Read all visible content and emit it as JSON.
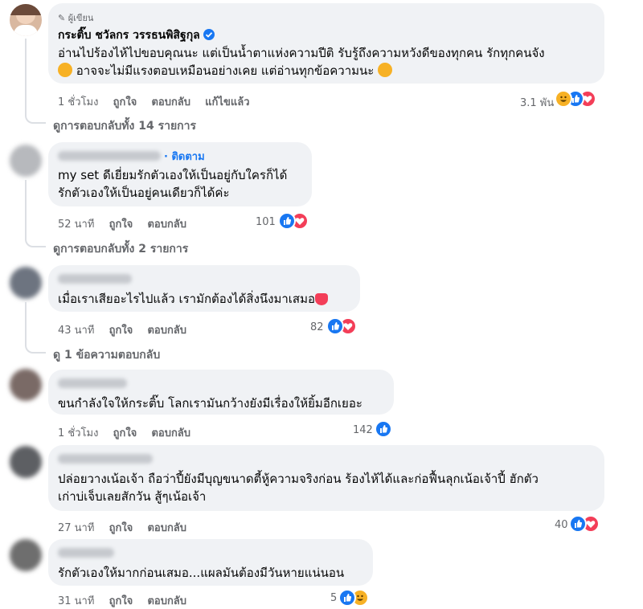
{
  "comments": [
    {
      "author_badge": "ผู้เขียน",
      "author": "กระติ๊บ ชวัลกร วรรธนพิสิฐกุล",
      "lines": [
        "อ่านไปร้องไห้ไปขอบคุณนะ แต่เป็นน้ำตาแห่งความปีติ รับรู้ถึงความหวังดีของทุกคน รักทุกคนจัง",
        "อาจจะไม่มีแรงตอบเหมือนอย่างเคย แต่อ่านทุกข้อความนะ"
      ],
      "time": "1 ชั่วโมง",
      "like": "ถูกใจ",
      "reply": "ตอบกลับ",
      "edited": "แก้ไขแล้ว",
      "reaction_count": "3.1 พัน",
      "view_replies": "ดูการตอบกลับทั้ง 14 รายการ"
    },
    {
      "follow": "ติดตาม",
      "lines": [
        "my set ดีเยี่ยมรักตัวเองให้เป็นอยู่กับใครก็ได้",
        "รักตัวเองให้เป็นอยู่คนเดียวก็ได้ค่ะ"
      ],
      "time": "52 นาที",
      "like": "ถูกใจ",
      "reply": "ตอบกลับ",
      "reaction_count": "101",
      "view_replies": "ดูการตอบกลับทั้ง 2 รายการ"
    },
    {
      "lines": [
        "เมื่อเราเสียอะไรไปแล้ว เรามักต้องได้สิ่งนึงมาเสมอ"
      ],
      "time": "43 นาที",
      "like": "ถูกใจ",
      "reply": "ตอบกลับ",
      "reaction_count": "82",
      "view_replies": "ดู 1 ข้อความตอบกลับ"
    },
    {
      "lines": [
        "ขนกำลังใจให้กระติ๊บ โลกเรามันกว้างยังมีเรื่องให้ยิ้มอีกเยอะ"
      ],
      "time": "1 ชั่วโมง",
      "like": "ถูกใจ",
      "reply": "ตอบกลับ",
      "reaction_count": "142"
    },
    {
      "lines": [
        "ปล่อยวางเน้อเจ้า ถือว่าปี้ยังมีบุญขนาดตี้หู้ความจริงก่อน ร้องไห้ได้และก่อฟื้นลุกเน้อเจ้าปี้ ฮักตัว",
        "เก่าบ่เจ็บเลยสักวัน สู้ๆเน้อเจ้า"
      ],
      "time": "27 นาที",
      "like": "ถูกใจ",
      "reply": "ตอบกลับ",
      "reaction_count": "40"
    },
    {
      "lines": [
        "รักตัวเองให้มากก่อนเสมอ...แผลมันต้องมีวันหายแน่นอน"
      ],
      "time": "31 นาที",
      "like": "ถูกใจ",
      "reply": "ตอบกลับ",
      "reaction_count": "5"
    }
  ],
  "colors": {
    "like": "#1877f2",
    "love": "#f33e58",
    "haha": "#f7b125",
    "bubble": "#f0f2f5",
    "meta": "#65676b"
  },
  "icons": [
    "pencil-icon",
    "verified-badge-icon",
    "like-reaction-icon",
    "love-reaction-icon",
    "care-reaction-icon",
    "haha-reaction-icon",
    "heart-emoji-icon",
    "smiling-hearts-emoji-icon",
    "blowing-kiss-emoji-icon"
  ]
}
